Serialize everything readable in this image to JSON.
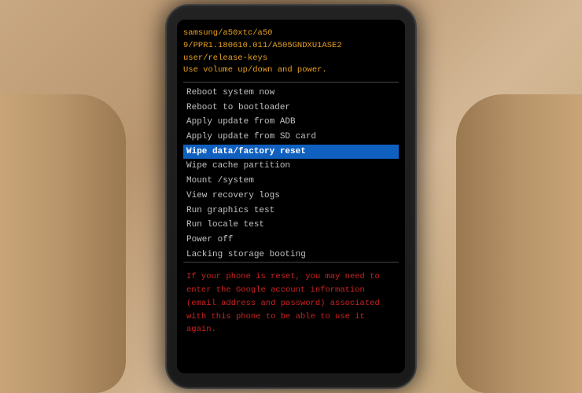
{
  "scene": {
    "bg_color": "#2a2a2a"
  },
  "phone": {
    "header": {
      "lines": [
        "samsung/a50xtc/a50",
        "9/PPR1.180610.011/A505GNDXU1ASE2",
        "user/release-keys",
        "Use volume up/down and power."
      ]
    },
    "menu": {
      "items": [
        {
          "label": "Reboot system now",
          "selected": false
        },
        {
          "label": "Reboot to bootloader",
          "selected": false
        },
        {
          "label": "Apply update from ADB",
          "selected": false
        },
        {
          "label": "Apply update from SD card",
          "selected": false
        },
        {
          "label": "Wipe data/factory reset",
          "selected": true
        },
        {
          "label": "Wipe cache partition",
          "selected": false
        },
        {
          "label": "Mount /system",
          "selected": false
        },
        {
          "label": "View recovery logs",
          "selected": false
        },
        {
          "label": "Run graphics test",
          "selected": false
        },
        {
          "label": "Run locale test",
          "selected": false
        },
        {
          "label": "Power off",
          "selected": false
        },
        {
          "label": "Lacking storage booting",
          "selected": false
        }
      ]
    },
    "warning": {
      "text": "If your phone is reset, you may need to enter the Google account information (email address and password) associated with this phone to be able to use it again."
    }
  }
}
